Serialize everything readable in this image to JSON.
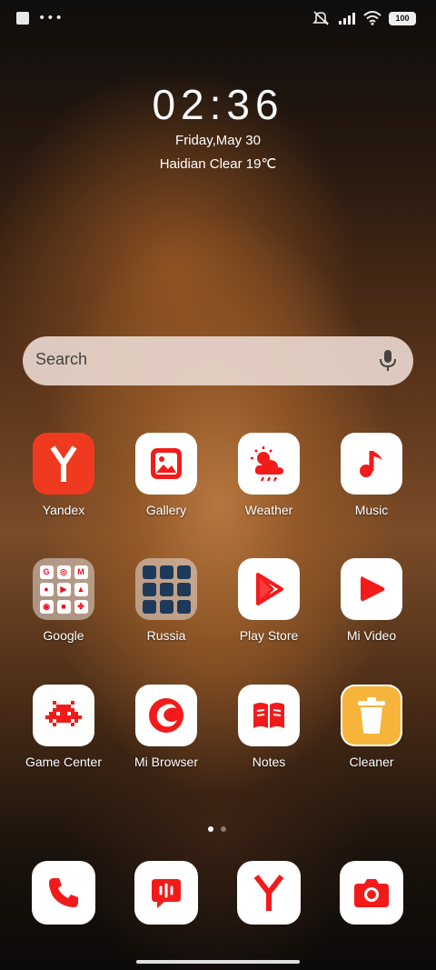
{
  "status_bar": {
    "battery": "100"
  },
  "clock": {
    "time": "02:36",
    "date": "Friday,May 30",
    "weather": "Haidian Clear 19℃"
  },
  "search": {
    "placeholder": "Search"
  },
  "apps": [
    {
      "label": "Yandex",
      "icon": "yandex-icon"
    },
    {
      "label": "Gallery",
      "icon": "gallery-icon"
    },
    {
      "label": "Weather",
      "icon": "weather-icon"
    },
    {
      "label": "Music",
      "icon": "music-icon"
    },
    {
      "label": "Google",
      "icon": "google-folder-icon"
    },
    {
      "label": "Russia",
      "icon": "russia-folder-icon"
    },
    {
      "label": "Play Store",
      "icon": "play-store-icon"
    },
    {
      "label": "Mi Video",
      "icon": "mi-video-icon"
    },
    {
      "label": "Game Center",
      "icon": "game-center-icon"
    },
    {
      "label": "Mi Browser",
      "icon": "mi-browser-icon"
    },
    {
      "label": "Notes",
      "icon": "notes-icon"
    },
    {
      "label": "Cleaner",
      "icon": "cleaner-icon"
    }
  ],
  "dock": [
    {
      "icon": "phone-icon"
    },
    {
      "icon": "messaging-icon"
    },
    {
      "icon": "yandex-browser-icon"
    },
    {
      "icon": "camera-icon"
    }
  ],
  "colors": {
    "accent": "#f21b1b",
    "yandex_bg": "#f03a20",
    "cleaner_bg": "#f6b43a"
  }
}
